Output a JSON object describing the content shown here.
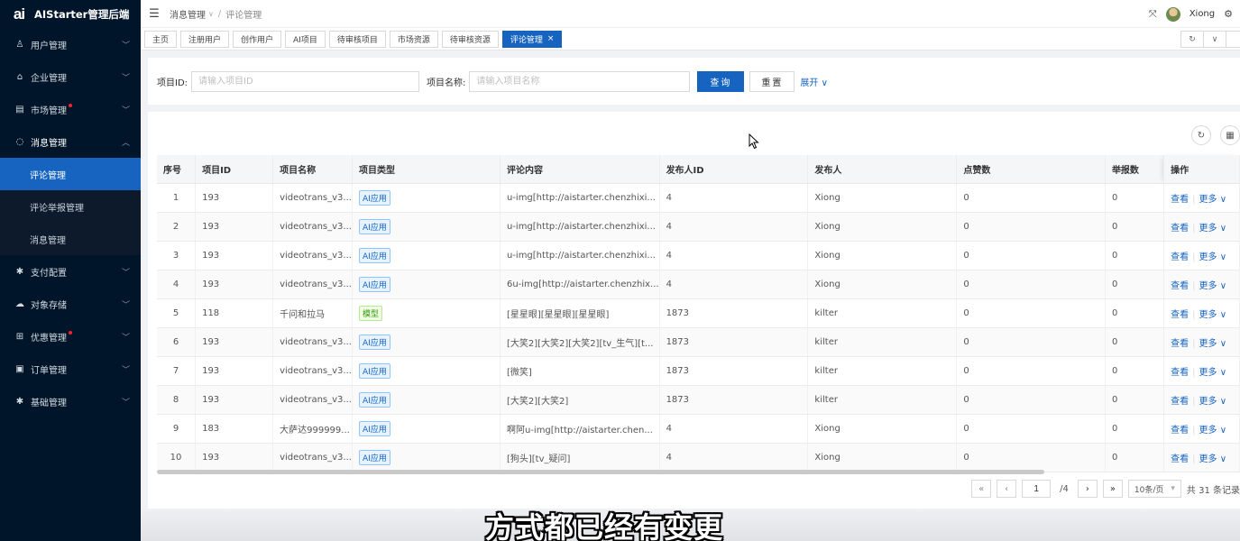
{
  "app": {
    "title": "AIStarter管理后端",
    "logo_text": "ai"
  },
  "sidebar": {
    "items": [
      {
        "label": "用户管理",
        "icon": "user-icon",
        "glyph": "♙"
      },
      {
        "label": "企业管理",
        "icon": "bank-icon",
        "glyph": "⌂"
      },
      {
        "label": "市场管理",
        "icon": "shop-icon",
        "glyph": "▤",
        "badge": true
      },
      {
        "label": "消息管理",
        "icon": "message-icon",
        "glyph": "◌",
        "open": true
      },
      {
        "label": "支付配置",
        "icon": "gear-icon",
        "glyph": "✱"
      },
      {
        "label": "对象存储",
        "icon": "cloud-icon",
        "glyph": "☁"
      },
      {
        "label": "优惠管理",
        "icon": "gift-icon",
        "glyph": "⊞",
        "badge": true
      },
      {
        "label": "订单管理",
        "icon": "order-icon",
        "glyph": "▣"
      },
      {
        "label": "基础管理",
        "icon": "settings-icon",
        "glyph": "✱"
      }
    ],
    "submenu": [
      {
        "label": "评论管理",
        "active": true
      },
      {
        "label": "评论举报管理"
      },
      {
        "label": "消息管理"
      }
    ]
  },
  "breadcrumb": {
    "parent": "消息管理",
    "current": "评论管理"
  },
  "user": {
    "name": "Xiong"
  },
  "tabs": [
    {
      "label": "主页"
    },
    {
      "label": "注册用户"
    },
    {
      "label": "创作用户"
    },
    {
      "label": "AI项目"
    },
    {
      "label": "待审核项目"
    },
    {
      "label": "市场资源"
    },
    {
      "label": "待审核资源"
    },
    {
      "label": "评论管理",
      "active": true
    }
  ],
  "search": {
    "id_label": "项目ID:",
    "id_placeholder": "请输入项目ID",
    "name_label": "项目名称:",
    "name_placeholder": "请输入项目名称",
    "query_button": "查询",
    "reset_button": "重置",
    "expand_link": "展开"
  },
  "table": {
    "columns": [
      "序号",
      "项目ID",
      "项目名称",
      "项目类型",
      "评论内容",
      "发布人ID",
      "发布人",
      "点赞数",
      "举报数",
      "操作"
    ],
    "rows": [
      {
        "idx": "1",
        "project_id": "193",
        "name": "videotrans_v3...",
        "type": "AI应用",
        "content": "u-img[http://aistarter.chenzhixi...",
        "publisher_id": "4",
        "publisher": "Xiong",
        "likes": "0",
        "reports": "0"
      },
      {
        "idx": "2",
        "project_id": "193",
        "name": "videotrans_v3...",
        "type": "AI应用",
        "content": "u-img[http://aistarter.chenzhixi...",
        "publisher_id": "4",
        "publisher": "Xiong",
        "likes": "0",
        "reports": "0"
      },
      {
        "idx": "3",
        "project_id": "193",
        "name": "videotrans_v3...",
        "type": "AI应用",
        "content": "u-img[http://aistarter.chenzhixi...",
        "publisher_id": "4",
        "publisher": "Xiong",
        "likes": "0",
        "reports": "0"
      },
      {
        "idx": "4",
        "project_id": "193",
        "name": "videotrans_v3...",
        "type": "AI应用",
        "content": "6u-img[http://aistarter.chenzhix...",
        "publisher_id": "4",
        "publisher": "Xiong",
        "likes": "0",
        "reports": "0"
      },
      {
        "idx": "5",
        "project_id": "118",
        "name": "千问和拉马",
        "type": "模型",
        "content": "[星星眼][星星眼][星星眼]",
        "publisher_id": "1873",
        "publisher": "kilter",
        "likes": "0",
        "reports": "0"
      },
      {
        "idx": "6",
        "project_id": "193",
        "name": "videotrans_v3...",
        "type": "AI应用",
        "content": "[大笑2][大笑2][大笑2][tv_生气][t...",
        "publisher_id": "1873",
        "publisher": "kilter",
        "likes": "0",
        "reports": "0"
      },
      {
        "idx": "7",
        "project_id": "193",
        "name": "videotrans_v3...",
        "type": "AI应用",
        "content": "[微笑]",
        "publisher_id": "1873",
        "publisher": "kilter",
        "likes": "0",
        "reports": "0"
      },
      {
        "idx": "8",
        "project_id": "193",
        "name": "videotrans_v3...",
        "type": "AI应用",
        "content": "[大笑2][大笑2]",
        "publisher_id": "1873",
        "publisher": "kilter",
        "likes": "0",
        "reports": "0"
      },
      {
        "idx": "9",
        "project_id": "183",
        "name": "大萨达999999...",
        "type": "AI应用",
        "content": "啊阿u-img[http://aistarter.chen...",
        "publisher_id": "4",
        "publisher": "Xiong",
        "likes": "0",
        "reports": "0"
      },
      {
        "idx": "10",
        "project_id": "193",
        "name": "videotrans_v3...",
        "type": "AI应用",
        "content": "[狗头][tv_疑问]",
        "publisher_id": "4",
        "publisher": "Xiong",
        "likes": "0",
        "reports": "0"
      }
    ],
    "view_label": "查看",
    "more_label": "更多"
  },
  "pagination": {
    "current_page": "1",
    "total_pages": "/4",
    "page_size": "10条/页",
    "total_text": "共 31 条记录"
  },
  "caption": "方式都已经有变更",
  "colors": {
    "primary": "#1664c0",
    "sidebar": "#001529"
  }
}
